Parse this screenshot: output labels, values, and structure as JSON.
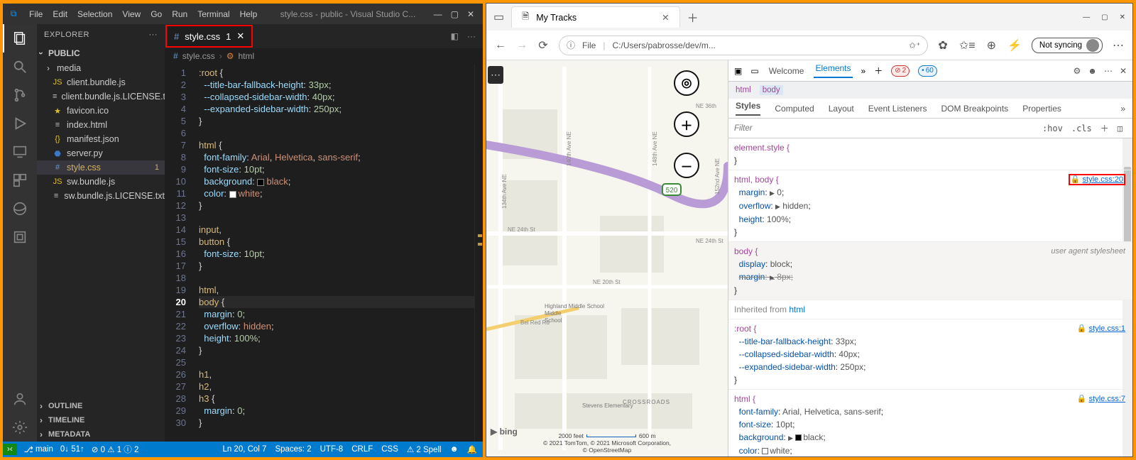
{
  "vscode": {
    "menu": [
      "File",
      "Edit",
      "Selection",
      "View",
      "Go",
      "Run",
      "Terminal",
      "Help"
    ],
    "title": "style.css - public - Visual Studio C...",
    "explorer_label": "EXPLORER",
    "folder": "PUBLIC",
    "tree": [
      {
        "icon": "i-folder",
        "name": "media"
      },
      {
        "icon": "i-js",
        "name": "client.bundle.js"
      },
      {
        "icon": "i-txt",
        "name": "client.bundle.js.LICENSE.txt"
      },
      {
        "icon": "i-star",
        "name": "favicon.ico"
      },
      {
        "icon": "i-txt",
        "name": "index.html"
      },
      {
        "icon": "i-json",
        "name": "manifest.json"
      },
      {
        "icon": "i-py",
        "name": "server.py"
      },
      {
        "icon": "i-css",
        "name": "style.css",
        "mod": true,
        "badge": "1",
        "sel": true
      },
      {
        "icon": "i-js",
        "name": "sw.bundle.js"
      },
      {
        "icon": "i-txt",
        "name": "sw.bundle.js.LICENSE.txt"
      }
    ],
    "collapsed": [
      "OUTLINE",
      "TIMELINE",
      "METADATA"
    ],
    "tab": {
      "name": "style.css",
      "badge": "1"
    },
    "crumbs": [
      "style.css",
      "html"
    ],
    "code": [
      [
        1,
        "<span class='csel'>:root</span> <span class='cpun'>{</span>"
      ],
      [
        2,
        "  <span class='cprop'>--title-bar-fallback-height</span><span class='cpun'>:</span> <span class='cnum'>33px</span><span class='cpun'>;</span>"
      ],
      [
        3,
        "  <span class='cprop'>--collapsed-sidebar-width</span><span class='cpun'>:</span> <span class='cnum'>40px</span><span class='cpun'>;</span>"
      ],
      [
        4,
        "  <span class='cprop'>--expanded-sidebar-width</span><span class='cpun'>:</span> <span class='cnum'>250px</span><span class='cpun'>;</span>"
      ],
      [
        5,
        "<span class='cpun'>}</span>"
      ],
      [
        6,
        ""
      ],
      [
        7,
        "<span class='csel'>html</span> <span class='cpun'>{</span>"
      ],
      [
        8,
        "  <span class='cprop'>font-family</span><span class='cpun'>:</span> <span class='cval'>Arial</span><span class='cpun'>,</span> <span class='cval'>Helvetica</span><span class='cpun'>,</span> <span class='cval'>sans-serif</span><span class='cpun'>;</span>"
      ],
      [
        9,
        "  <span class='cprop'>font-size</span><span class='cpun'>:</span> <span class='cnum'>10pt</span><span class='cpun'>;</span>"
      ],
      [
        10,
        "  <span class='cprop'>background</span><span class='cpun'>:</span> <span class='ccol' style='background:#000'></span><span class='cval'>black</span><span class='cpun'>;</span>"
      ],
      [
        11,
        "  <span class='cprop'>color</span><span class='cpun'>:</span> <span class='ccol' style='background:#fff'></span><span class='cval'>white</span><span class='cpun'>;</span>"
      ],
      [
        12,
        "<span class='cpun'>}</span>"
      ],
      [
        13,
        ""
      ],
      [
        14,
        "<span class='csel'>input</span><span class='cpun'>,</span>"
      ],
      [
        15,
        "<span class='csel'>button</span> <span class='cpun'>{</span>"
      ],
      [
        16,
        "  <span class='cprop'>font-size</span><span class='cpun'>:</span> <span class='cnum'>10pt</span><span class='cpun'>;</span>"
      ],
      [
        17,
        "<span class='cpun'>}</span>"
      ],
      [
        18,
        ""
      ],
      [
        19,
        "<span class='csel'>html</span><span class='cpun'>,</span>"
      ],
      [
        20,
        "<span class='csel'>body</span> <span class='cpun'>{</span>",
        "cur"
      ],
      [
        21,
        "  <span class='cprop'>margin</span><span class='cpun'>:</span> <span class='cnum'>0</span><span class='cpun'>;</span>"
      ],
      [
        22,
        "  <span class='cprop'>overflow</span><span class='cpun'>:</span> <span class='cval'>hidden</span><span class='cpun'>;</span>"
      ],
      [
        23,
        "  <span class='cprop'>height</span><span class='cpun'>:</span> <span class='cnum'>100%</span><span class='cpun'>;</span>"
      ],
      [
        24,
        "<span class='cpun'>}</span>"
      ],
      [
        25,
        ""
      ],
      [
        26,
        "<span class='csel'>h1</span><span class='cpun'>,</span>"
      ],
      [
        27,
        "<span class='csel'>h2</span><span class='cpun'>,</span>"
      ],
      [
        28,
        "<span class='csel'>h3</span> <span class='cpun'>{</span>"
      ],
      [
        29,
        "  <span class='cprop'>margin</span><span class='cpun'>:</span> <span class='cnum'>0</span><span class='cpun'>;</span>"
      ],
      [
        30,
        "<span class='cpun'>}</span>"
      ]
    ],
    "status": {
      "branch": "main",
      "sync": "0↓ 51↑",
      "problems": "⊘ 0 ⚠ 1 ⓘ 2",
      "pos": "Ln 20, Col 7",
      "spaces": "Spaces: 2",
      "enc": "UTF-8",
      "eol": "CRLF",
      "lang": "CSS",
      "spell": "⚠ 2 Spell"
    }
  },
  "browser": {
    "tab_title": "My Tracks",
    "url_label": "File",
    "url_sep": "|",
    "url": "C:/Users/pabrosse/dev/m...",
    "sync": "Not syncing",
    "map": {
      "roads": [
        "148th Ave NE",
        "140th Ave NE",
        "134th Ave NE",
        "152nd Ave NE"
      ],
      "streets": [
        "NE 36th",
        "NE 24th St",
        "NE 20th St",
        "Bel Red Rd"
      ],
      "places": [
        "Highland Middle School",
        "Stevens Elementary",
        "CROSSROADS"
      ],
      "scale": [
        "2000 feet",
        "600 m"
      ],
      "badge": "520",
      "brand": "▶ bing",
      "credit1": "© 2021 TomTom, © 2021 Microsoft Corporation,",
      "credit2": "© OpenStreetMap"
    },
    "devtools": {
      "tabs_top": [
        "Welcome",
        "Elements"
      ],
      "err": "2",
      "info": "60",
      "crumbs": [
        "html",
        "body"
      ],
      "tabs2": [
        "Styles",
        "Computed",
        "Layout",
        "Event Listeners",
        "DOM Breakpoints",
        "Properties"
      ],
      "filter": "Filter",
      "hov": ":hov",
      "cls": ".cls",
      "rules": [
        {
          "sel": "element.style {",
          "lines": [],
          "close": "}"
        },
        {
          "sel": "html, body {",
          "src": "style.css:20",
          "srcbox": true,
          "lines": [
            "<span class='prop2'>margin</span>: <span class='tri'>▶</span> <span class='val2'>0</span>;",
            "<span class='prop2'>overflow</span>: <span class='tri'>▶</span> <span class='val2'>hidden</span>;",
            "<span class='prop2'>height</span>: <span class='val2'>100%</span>;"
          ],
          "close": "}"
        },
        {
          "sel": "body {",
          "ua": "user agent stylesheet",
          "lines": [
            "<span class='prop2'>display</span>: <span class='val2'>block</span>;",
            "<span class='str'><span class='prop2'>margin</span>: <span class='tri'>▶</span> 8px;</span>"
          ],
          "close": "}",
          "uablock": true
        },
        {
          "inh": "Inherited from html"
        },
        {
          "sel": ":root {",
          "src": "style.css:1",
          "lines": [
            "<span class='prop2'>--title-bar-fallback-height</span>: <span class='val2'>33px</span>;",
            "<span class='prop2'>--collapsed-sidebar-width</span>: <span class='val2'>40px</span>;",
            "<span class='prop2'>--expanded-sidebar-width</span>: <span class='val2'>250px</span>;"
          ],
          "close": "}"
        },
        {
          "sel": "html {",
          "src": "style.css:7",
          "lines": [
            "<span class='prop2'>font-family</span>: <span class='val2'>Arial, Helvetica, sans-serif</span>;",
            "<span class='prop2'>font-size</span>: <span class='val2'>10pt</span>;",
            "<span class='prop2'>background</span>: <span class='tri'>▶</span> <span class='swatch' style='background:#000'></span><span class='val2'>black</span>;",
            "<span class='prop2'>color</span>: <span class='swatch' style='background:#fff'></span><span class='val2'>white</span>;"
          ],
          "close": ""
        }
      ]
    }
  }
}
